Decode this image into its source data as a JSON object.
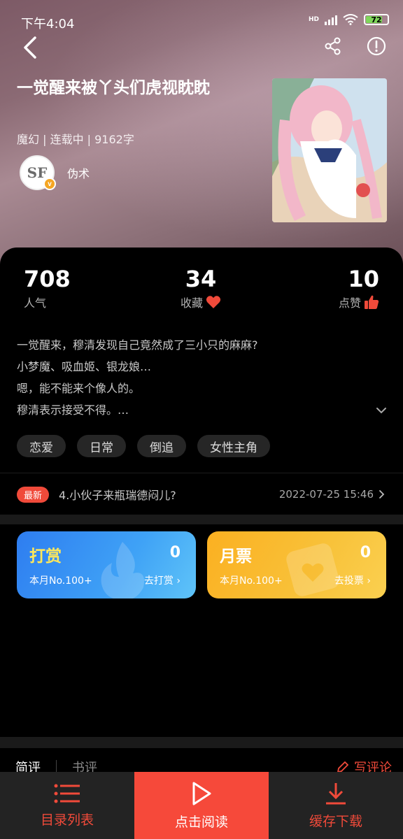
{
  "status": {
    "time": "下午4:04",
    "battery": "72"
  },
  "book": {
    "title": "一觉醒来被丫头们虎视眈眈",
    "meta": "魔幻 | 连载中 | 9162字",
    "author": "伪术",
    "avatar_text": "SF",
    "avatar_badge": "v"
  },
  "stats": [
    {
      "value": "708",
      "label": "人气"
    },
    {
      "value": "34",
      "label": "收藏"
    },
    {
      "value": "10",
      "label": "点赞"
    }
  ],
  "description": [
    "一觉醒来，穆清发现自己竟然成了三小只的麻麻?",
    "小梦魔、吸血姬、银龙娘…",
    "嗯，能不能来个像人的。",
    "穆清表示接受不得。…"
  ],
  "tags": [
    "恋爱",
    "日常",
    "倒追",
    "女性主角"
  ],
  "latest": {
    "badge": "最新",
    "title": "4.小伙子来瓶瑞德闷儿?",
    "time": "2022-07-25 15:46"
  },
  "cards": {
    "reward": {
      "title": "打赏",
      "count": "0",
      "rank": "本月No.100+",
      "action": "去打赏"
    },
    "ticket": {
      "title": "月票",
      "count": "0",
      "rank": "本月No.100+",
      "action": "去投票"
    }
  },
  "reviews": {
    "tab_short": "简评",
    "tab_long": "书评",
    "write": "写评论"
  },
  "bottom": {
    "catalog": "目录列表",
    "read": "点击阅读",
    "download": "缓存下载"
  },
  "colors": {
    "accent": "#f04a3a",
    "reward_blue": "#3fa2f6",
    "ticket_yellow": "#f8c23a"
  }
}
